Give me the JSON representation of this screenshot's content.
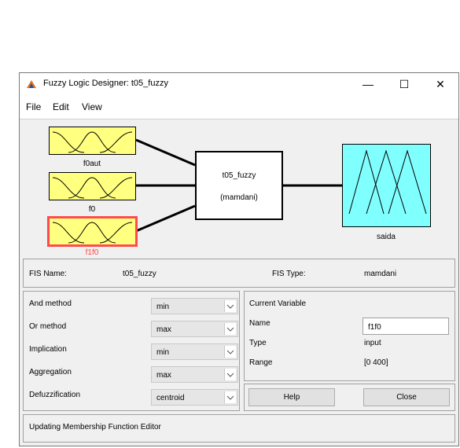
{
  "window": {
    "title": "Fuzzy Logic Designer: t05_fuzzy",
    "minimize": "—",
    "maximize": "☐",
    "close": "✕"
  },
  "menu": [
    "File",
    "Edit",
    "View"
  ],
  "inputs": [
    {
      "name": "f0aut"
    },
    {
      "name": "f0"
    },
    {
      "name": "f1f0"
    }
  ],
  "system": {
    "name": "t05_fuzzy",
    "type": "(mamdani)"
  },
  "output": {
    "name": "saida"
  },
  "info": {
    "fis_name_label": "FIS Name:",
    "fis_name": "t05_fuzzy",
    "fis_type_label": "FIS Type:",
    "fis_type": "mamdani"
  },
  "methods": [
    {
      "label": "And method",
      "value": "min"
    },
    {
      "label": "Or method",
      "value": "max"
    },
    {
      "label": "Implication",
      "value": "min"
    },
    {
      "label": "Aggregation",
      "value": "max"
    },
    {
      "label": "Defuzzification",
      "value": "centroid"
    }
  ],
  "current_variable": {
    "heading": "Current Variable",
    "name_label": "Name",
    "name": "f1f0",
    "type_label": "Type",
    "type": "input",
    "range_label": "Range",
    "range": "[0 400]"
  },
  "buttons": {
    "help": "Help",
    "close": "Close"
  },
  "status": "Updating Membership Function Editor",
  "colors": {
    "input_box": "#ffff80",
    "output_box": "#80ffff",
    "selected_border": "#ff4b4b"
  }
}
